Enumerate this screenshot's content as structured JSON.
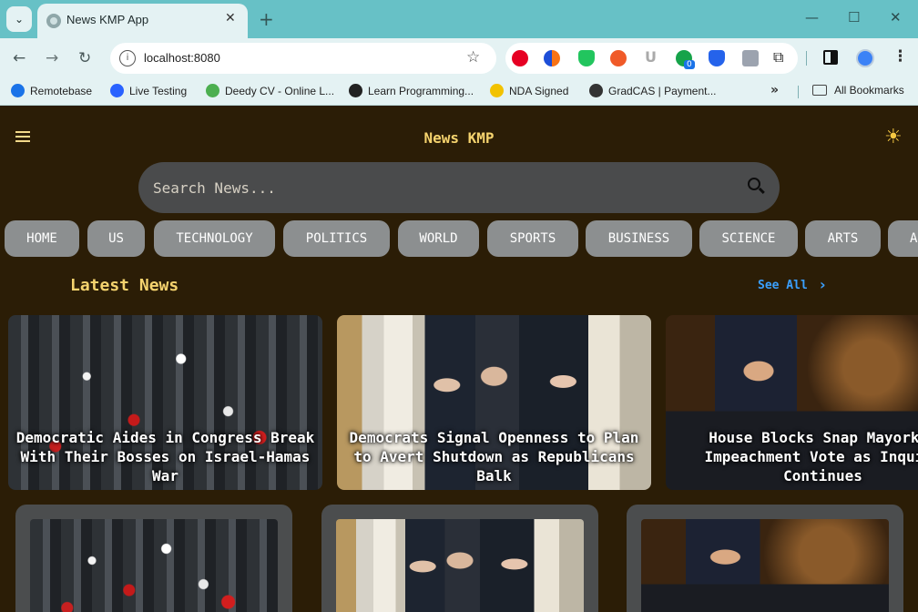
{
  "browser": {
    "tab": {
      "title": "News KMP App",
      "close": "✕"
    },
    "new_tab": "+",
    "window_controls": {
      "minimize": "—",
      "maximize": "☐",
      "close": "✕"
    },
    "toolbar": {
      "back": "←",
      "forward": "→",
      "reload": "↻",
      "url": "localhost:8080",
      "star": "☆",
      "menu": "⋮"
    },
    "extension_badge": "0",
    "bookmarks": [
      {
        "label": "Remotebase",
        "color": "#1a73e8"
      },
      {
        "label": "Live Testing",
        "color": "#2962ff"
      },
      {
        "label": "Deedy CV - Online L...",
        "color": "#4caf50"
      },
      {
        "label": "Learn Programming...",
        "color": "#222222"
      },
      {
        "label": "NDA Signed",
        "color": "#f2c200"
      },
      {
        "label": "GradCAS | Payment...",
        "color": "#333333"
      }
    ],
    "bookmarks_more": "»",
    "all_bookmarks": "All Bookmarks"
  },
  "app": {
    "title": "News KMP",
    "theme_icon": "☀",
    "search": {
      "placeholder": "Search News..."
    },
    "categories": [
      "HOME",
      "US",
      "TECHNOLOGY",
      "POLITICS",
      "WORLD",
      "SPORTS",
      "BUSINESS",
      "SCIENCE",
      "ARTS",
      "AUTOMOBILES"
    ],
    "latest": {
      "title": "Latest News",
      "see_all": "See All",
      "chevron": "›"
    },
    "headlines": [
      "Democratic Aides in Congress Break With Their Bosses on Israel-Hamas War",
      "Democrats Signal Openness to Plan to Avert Shutdown as Republicans Balk",
      "House Blocks Snap Mayorkas Impeachment Vote as Inquiry Continues"
    ],
    "colors": {
      "background": "#2b1d06",
      "accent": "#f5d36e",
      "link": "#3aa0ff",
      "chip": "#8c8f90",
      "search": "#4a4b4c"
    }
  }
}
